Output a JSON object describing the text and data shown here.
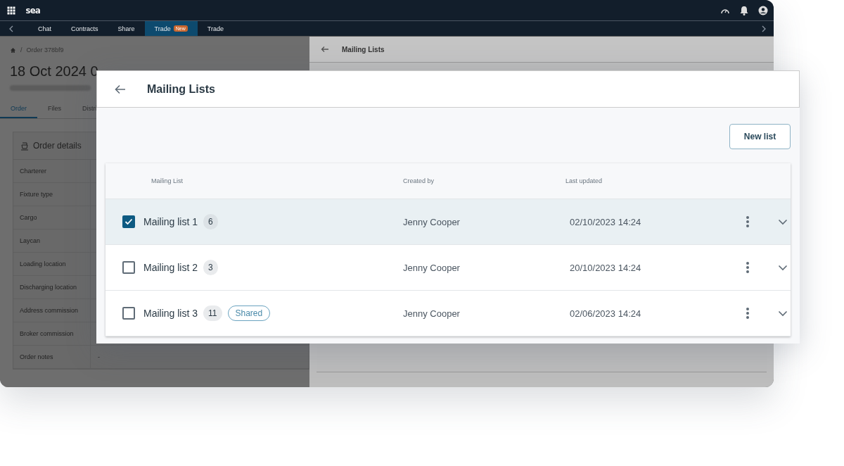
{
  "app": {
    "logo": "sea",
    "nav_tabs": [
      {
        "label": "Chat",
        "selected": false
      },
      {
        "label": "Contracts",
        "selected": false
      },
      {
        "label": "Share",
        "selected": false
      },
      {
        "label": "Trade",
        "badge": "New",
        "selected": true
      },
      {
        "label": "Trade",
        "selected": false
      }
    ]
  },
  "breadcrumb": {
    "separator": "/",
    "current": "Order 378bf9"
  },
  "title": "18 Oct 2024 0",
  "tabs": [
    {
      "label": "Order",
      "selected": true
    },
    {
      "label": "Files",
      "selected": false
    },
    {
      "label": "Distri",
      "selected": false
    }
  ],
  "order_details": {
    "title": "Order details",
    "rows": [
      {
        "label": "Charterer"
      },
      {
        "label": "Fixture type"
      },
      {
        "label": "Cargo"
      },
      {
        "label": "Laycan"
      },
      {
        "label": "Loading location"
      },
      {
        "label": "Discharging location"
      },
      {
        "label": "Address commission"
      },
      {
        "label": "Broker commission"
      },
      {
        "label": "Order notes",
        "value": "-"
      }
    ]
  },
  "side_panel": {
    "title": "Mailing Lists"
  },
  "dialog": {
    "title": "Mailing Lists",
    "new_list_button": "New list",
    "columns": [
      "Mailing List",
      "Created by",
      "Last updated"
    ],
    "rows": [
      {
        "name": "Mailing list 1",
        "count": "6",
        "checked": true,
        "selected": true,
        "created_by": "Jenny Cooper",
        "last_updated": "02/10/2023 14:24"
      },
      {
        "name": "Mailing list 2",
        "count": "3",
        "checked": false,
        "selected": false,
        "created_by": "Jenny Cooper",
        "last_updated": "20/10/2023 14:24"
      },
      {
        "name": "Mailing list 3",
        "count": "11",
        "tag": "Shared",
        "checked": false,
        "selected": false,
        "created_by": "Jenny Cooper",
        "last_updated": "02/06/2023 14:24"
      }
    ]
  }
}
